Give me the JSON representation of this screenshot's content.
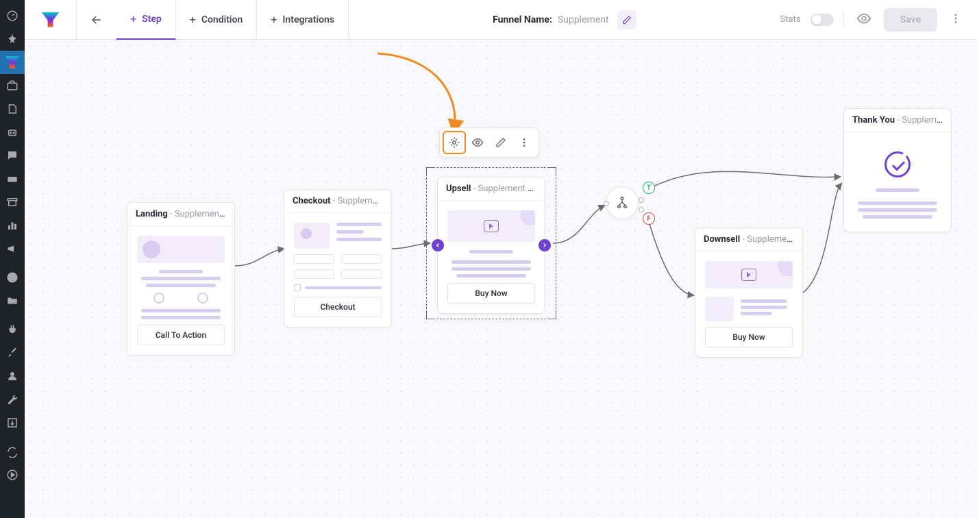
{
  "topbar": {
    "tabs": {
      "step": "Step",
      "condition": "Condition",
      "integrations": "Integrations"
    },
    "funnel_label": "Funnel Name:",
    "funnel_value": "Supplement",
    "stats": "Stats",
    "save": "Save"
  },
  "nodes": {
    "landing": {
      "title": "Landing",
      "sub": " - Supplement La...",
      "cta": "Call To Action"
    },
    "checkout": {
      "title": "Checkout",
      "sub": " - Supplement C...",
      "cta": "Checkout"
    },
    "upsell": {
      "title": "Upsell",
      "sub": " - Supplement U...",
      "cta": "Buy Now"
    },
    "downsell": {
      "title": "Downsell",
      "sub": " - Supplement D...",
      "cta": "Buy Now"
    },
    "thankyou": {
      "title": "Thank You",
      "sub": " - Supplement T..."
    }
  },
  "branch": {
    "t": "T",
    "f": "F"
  }
}
